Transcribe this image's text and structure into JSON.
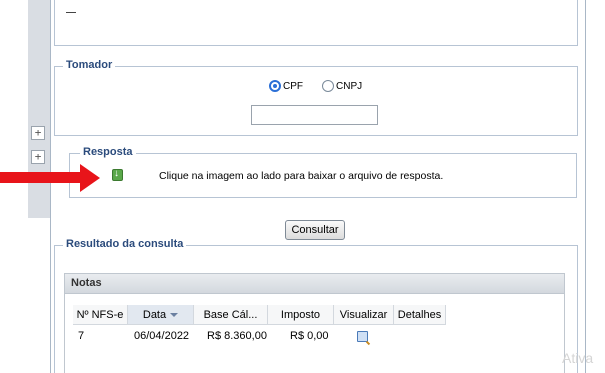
{
  "tomador": {
    "legend": "Tomador",
    "radio_cpf": "CPF",
    "radio_cnpj": "CNPJ",
    "selected": "CPF",
    "document_value": ""
  },
  "resposta": {
    "legend": "Resposta",
    "message": "Clique na imagem ao lado para baixar o arquivo de resposta."
  },
  "consultar_label": "Consultar",
  "resultado": {
    "legend": "Resultado da consulta",
    "grid_title": "Notas",
    "columns": [
      "Nº NFS-e",
      "Data",
      "Base Cál...",
      "Imposto",
      "Visualizar",
      "Detalhes"
    ],
    "rows": [
      {
        "numero": "7",
        "data": "06/04/2022",
        "base": "R$ 8.360,00",
        "imposto": "R$ 0,00"
      }
    ]
  },
  "expanders": [
    "+",
    "+"
  ],
  "watermark": "Ativa",
  "colors": {
    "accent": "#2b4b7c",
    "arrow": "#e8141a",
    "radio": "#2b6fd6"
  },
  "icons": {
    "download": "download-icon",
    "view": "magnifier-icon"
  }
}
